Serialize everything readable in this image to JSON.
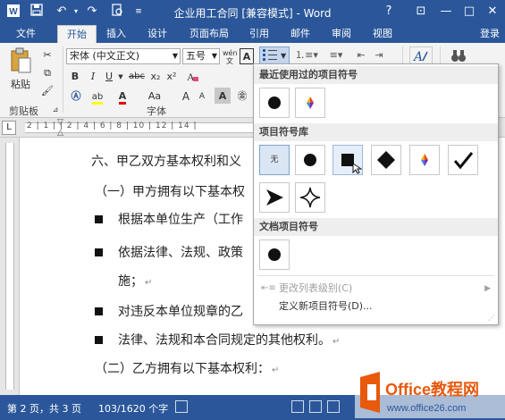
{
  "window": {
    "title": "企业用工合同 [兼容模式] - Word",
    "help": "?",
    "restore_ribbon": "⊡",
    "minimize": "—",
    "maximize": "□",
    "close": "✕"
  },
  "quick_access": {
    "save_icon": "save-icon",
    "undo_icon": "undo-icon",
    "redo_icon": "redo-icon",
    "preview_icon": "print-preview-icon"
  },
  "tabs": [
    {
      "label": "文件"
    },
    {
      "label": "开始"
    },
    {
      "label": "插入"
    },
    {
      "label": "设计"
    },
    {
      "label": "页面布局"
    },
    {
      "label": "引用"
    },
    {
      "label": "邮件"
    },
    {
      "label": "审阅"
    },
    {
      "label": "视图"
    }
  ],
  "login": "登录",
  "ribbon": {
    "clipboard": {
      "paste_label": "粘贴",
      "group_label": "剪贴板"
    },
    "font": {
      "font_name": "宋体 (中文正文)",
      "font_size": "五号",
      "wen": "wén",
      "A_box": "A",
      "bold": "B",
      "italic": "I",
      "underline": "U",
      "strike": "abc",
      "subscript": "x₂",
      "superscript": "x²",
      "case": "Aa",
      "grow": "A",
      "shrink": "A",
      "font_color": "A",
      "highlight": "ab",
      "group_label": "字体"
    }
  },
  "ruler": {
    "tab_selector": "L",
    "ticks": "2 | 1 | | 2 | 4 | 6 | 8 | 10 | 12 | 14 |"
  },
  "document": {
    "lines": [
      "六、甲乙双方基本权利和义",
      "（一）甲方拥有以下基本权",
      "根据本单位生产（工作",
      "依据法律、法规、政策",
      "施；",
      "对违反本单位规章的乙",
      "法律、法规和本合同规定的其他权利。",
      "（二）乙方拥有以下基本权利："
    ],
    "para_mark": "↵"
  },
  "bullet_panel": {
    "recent_header": "最近使用过的项目符号",
    "library_header": "项目符号库",
    "document_header": "文档项目符号",
    "none_label": "无",
    "menu_change_level": "更改列表级别(C)",
    "menu_define_new": "定义新项目符号(D)...",
    "recent": [
      "filled-circle-icon",
      "colorful-diamond-icon"
    ],
    "library": [
      "none",
      "filled-circle-icon",
      "filled-square-icon",
      "filled-diamond-icon",
      "colorful-diamond-icon",
      "checkmark-icon",
      "arrow-pointer-icon",
      "four-point-star-icon"
    ],
    "document": [
      "filled-circle-icon"
    ]
  },
  "statusbar": {
    "page": "第 2 页，共 3 页",
    "words": "103/1620 个字"
  },
  "watermark": {
    "brand": "Office教程网",
    "url": "www.office26.com"
  },
  "colors": {
    "title_blue": "#2b579a",
    "ribbon_bg": "#f3f3f3",
    "selected_cell": "#dbe6f4",
    "logo_orange": "#e8590c"
  }
}
